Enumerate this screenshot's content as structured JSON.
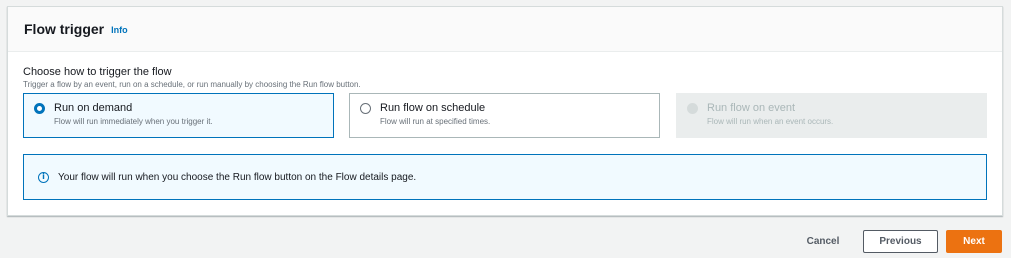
{
  "panel": {
    "title": "Flow trigger",
    "info_label": "Info"
  },
  "trigger": {
    "label": "Choose how to trigger the flow",
    "description": "Trigger a flow by an event, run on a schedule, or run manually by choosing the Run flow button.",
    "options": [
      {
        "title": "Run on demand",
        "description": "Flow will run immediately when you trigger it.",
        "state": "selected"
      },
      {
        "title": "Run flow on schedule",
        "description": "Flow will run at specified times.",
        "state": "unselected"
      },
      {
        "title": "Run flow on event",
        "description": "Flow will run when an event occurs.",
        "state": "disabled"
      }
    ]
  },
  "alert": {
    "icon": "info-icon",
    "text": "Your flow will run when you choose the Run flow button on the Flow details page."
  },
  "actions": {
    "cancel_label": "Cancel",
    "previous_label": "Previous",
    "next_label": "Next"
  },
  "colors": {
    "accent": "#0073bb",
    "primary_button": "#ec7211",
    "background": "#f2f3f3"
  }
}
